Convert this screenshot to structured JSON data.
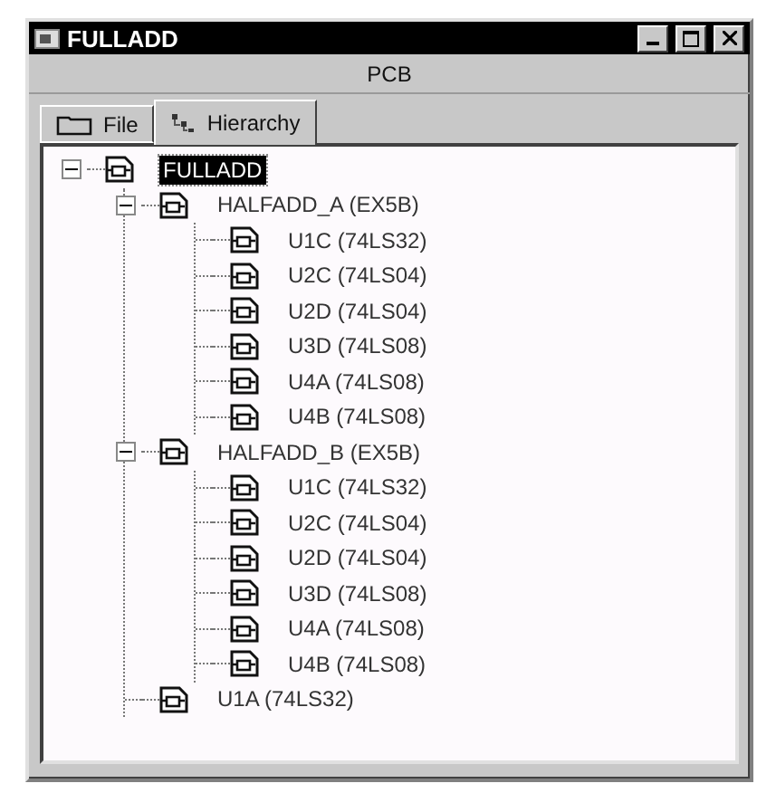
{
  "window": {
    "title": "FULLADD"
  },
  "header": "PCB",
  "tabs": [
    {
      "label": "File",
      "kind": "folder",
      "selected": false
    },
    {
      "label": "Hierarchy",
      "kind": "hierarchy",
      "selected": true
    }
  ],
  "tree": [
    {
      "label": "FULLADD",
      "selected": true,
      "expanded": true,
      "children": [
        {
          "label": "HALFADD_A (EX5B)",
          "selected": false,
          "expanded": true,
          "children": [
            {
              "label": "U1C (74LS32)",
              "selected": false
            },
            {
              "label": "U2C (74LS04)",
              "selected": false
            },
            {
              "label": "U2D (74LS04)",
              "selected": false
            },
            {
              "label": "U3D (74LS08)",
              "selected": false
            },
            {
              "label": "U4A (74LS08)",
              "selected": false
            },
            {
              "label": "U4B (74LS08)",
              "selected": false
            }
          ]
        },
        {
          "label": "HALFADD_B (EX5B)",
          "selected": false,
          "expanded": true,
          "children": [
            {
              "label": "U1C (74LS32)",
              "selected": false
            },
            {
              "label": "U2C (74LS04)",
              "selected": false
            },
            {
              "label": "U2D (74LS04)",
              "selected": false
            },
            {
              "label": "U3D (74LS08)",
              "selected": false
            },
            {
              "label": "U4A (74LS08)",
              "selected": false
            },
            {
              "label": "U4B (74LS08)",
              "selected": false
            }
          ]
        },
        {
          "label": "U1A (74LS32)",
          "selected": false
        }
      ]
    }
  ]
}
